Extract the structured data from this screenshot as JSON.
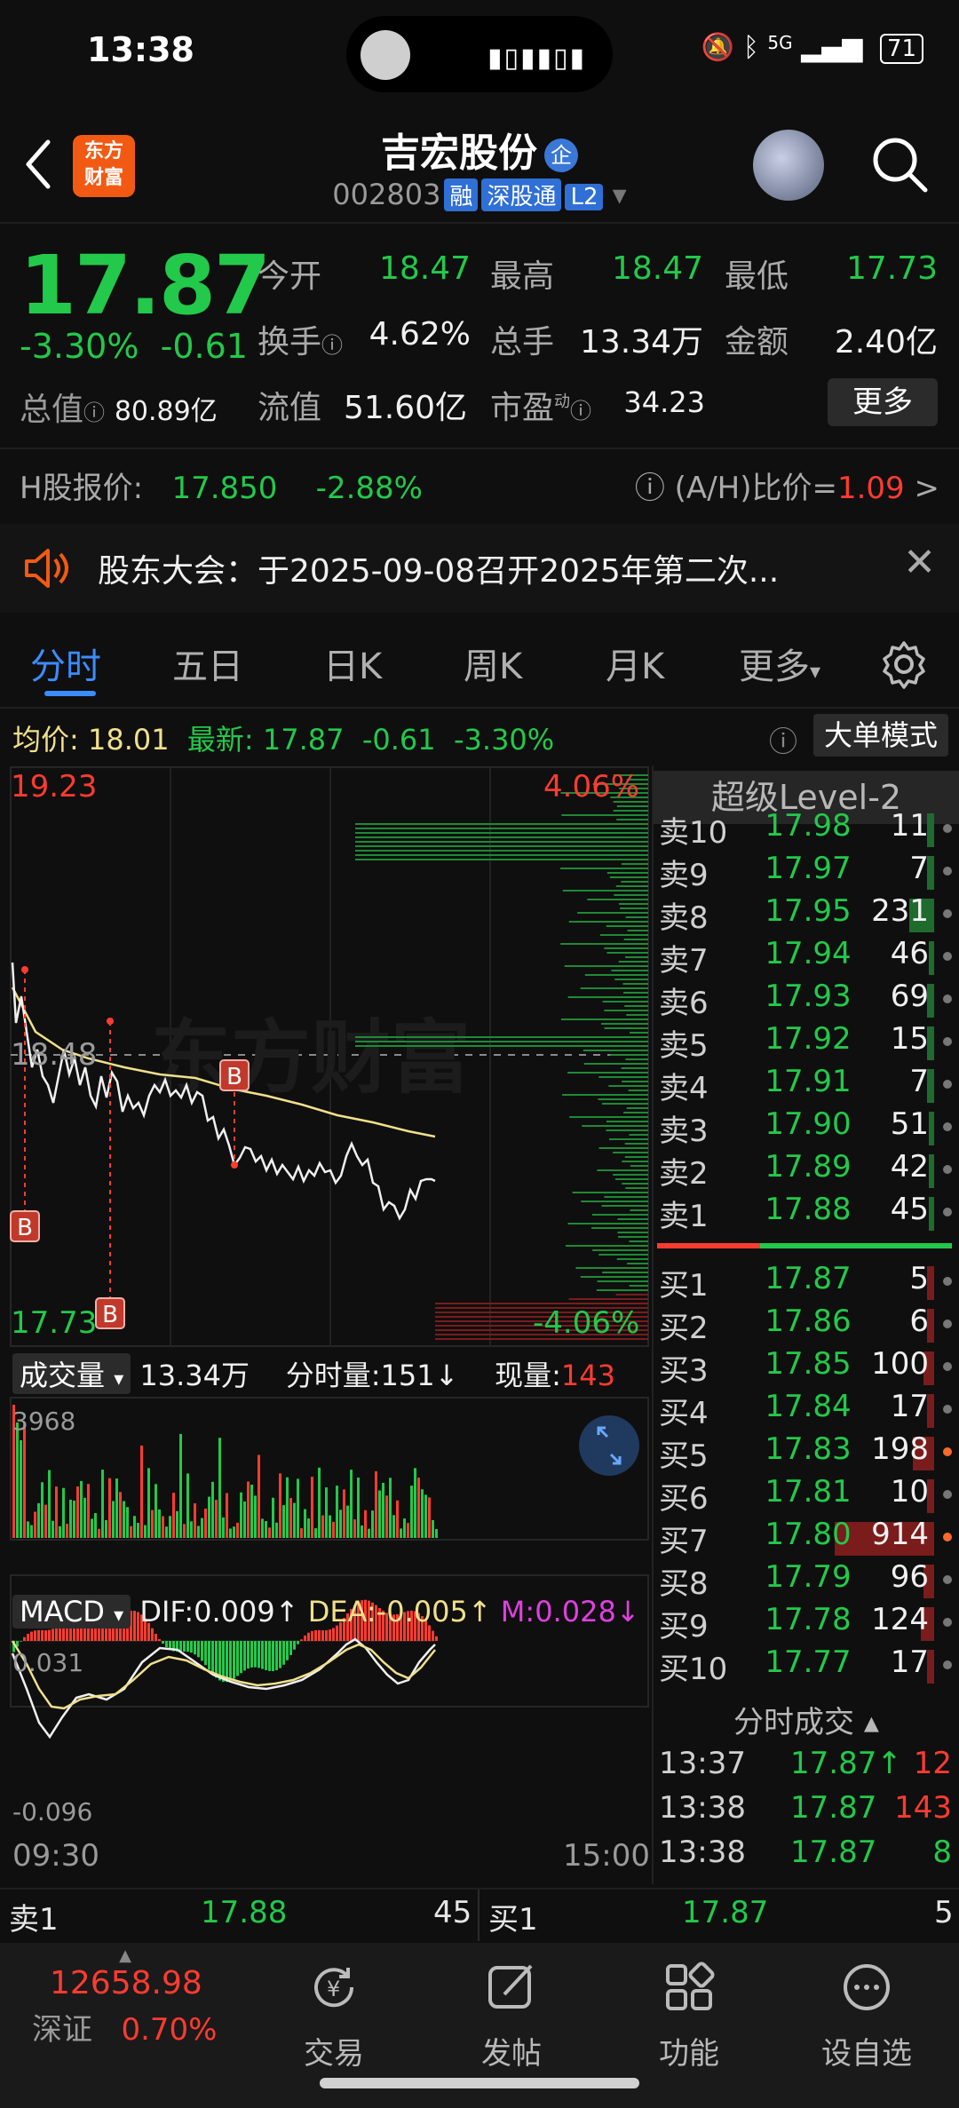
{
  "status": {
    "time": "13:38",
    "network": "5G",
    "battery": "71"
  },
  "header": {
    "logo_line1": "东方",
    "logo_line2": "财富",
    "name": "吉宏股份",
    "name_badge": "企",
    "code": "002803",
    "tags": [
      "融",
      "深股通",
      "L2"
    ]
  },
  "quote": {
    "price": "17.87",
    "chg_pct": "-3.30%",
    "chg": "-0.61",
    "labels": {
      "open": "今开",
      "high": "最高",
      "low": "最低",
      "turnover": "换手",
      "vol": "总手",
      "amount": "金额",
      "mktcap": "总值",
      "float": "流值",
      "pe": "市盈",
      "pe_sup": "动"
    },
    "open": "18.47",
    "high": "18.47",
    "low": "17.73",
    "turnover": "4.62%",
    "vol": "13.34万",
    "amount": "2.40亿",
    "mktcap": "80.89亿",
    "float": "51.60亿",
    "pe": "34.23",
    "more": "更多"
  },
  "hshare": {
    "label": "H股报价:",
    "price": "17.850",
    "pct": "-2.88%",
    "ah_label": "(A/H)比价=",
    "ah": "1.09",
    "arrow": ">"
  },
  "notice": {
    "text": "股东大会：于2025-09-08召开2025年第二次..."
  },
  "tabs": [
    "分时",
    "五日",
    "日K",
    "周K",
    "月K",
    "更多"
  ],
  "avg": {
    "avg_label": "均价:",
    "avg": "18.01",
    "latest_label": "最新:",
    "latest": "17.87",
    "chg": "-0.61",
    "pct": "-3.30%",
    "big_order": "大单模式"
  },
  "chart": {
    "y_high": "19.23",
    "y_high_pct": "4.06%",
    "y_mid": "18.48",
    "y_low": "17.73",
    "y_low_pct": "-4.06%",
    "watermark": "东方财富",
    "vol_label": "成交量",
    "vol_total": "13.34万",
    "tick_vol_label": "分时量:",
    "tick_vol": "151↓",
    "cur_vol_label": "现量:",
    "cur_vol": "143",
    "vol_max": "3968",
    "macd_label": "MACD",
    "dif": "DIF:0.009↑",
    "dea": "DEA:-0.005↑",
    "m": "M:0.028↓",
    "macd_top": "0.031",
    "macd_bot": "-0.096",
    "t_start": "09:30",
    "t_end": "15:00",
    "buy_marker": "B"
  },
  "level2": {
    "title": "超级Level-2",
    "asks": [
      {
        "label": "卖10",
        "price": "17.98",
        "vol": "11"
      },
      {
        "label": "卖9",
        "price": "17.97",
        "vol": "7"
      },
      {
        "label": "卖8",
        "price": "17.95",
        "vol": "231"
      },
      {
        "label": "卖7",
        "price": "17.94",
        "vol": "46"
      },
      {
        "label": "卖6",
        "price": "17.93",
        "vol": "69"
      },
      {
        "label": "卖5",
        "price": "17.92",
        "vol": "15"
      },
      {
        "label": "卖4",
        "price": "17.91",
        "vol": "7"
      },
      {
        "label": "卖3",
        "price": "17.90",
        "vol": "51"
      },
      {
        "label": "卖2",
        "price": "17.89",
        "vol": "42"
      },
      {
        "label": "卖1",
        "price": "17.88",
        "vol": "45"
      }
    ],
    "bids": [
      {
        "label": "买1",
        "price": "17.87",
        "vol": "5"
      },
      {
        "label": "买2",
        "price": "17.86",
        "vol": "6"
      },
      {
        "label": "买3",
        "price": "17.85",
        "vol": "100"
      },
      {
        "label": "买4",
        "price": "17.84",
        "vol": "17"
      },
      {
        "label": "买5",
        "price": "17.83",
        "vol": "198"
      },
      {
        "label": "买6",
        "price": "17.81",
        "vol": "10"
      },
      {
        "label": "买7",
        "price": "17.80",
        "vol": "914"
      },
      {
        "label": "买8",
        "price": "17.79",
        "vol": "96"
      },
      {
        "label": "买9",
        "price": "17.78",
        "vol": "124"
      },
      {
        "label": "买10",
        "price": "17.77",
        "vol": "17"
      }
    ],
    "trades_title": "分时成交",
    "trades": [
      {
        "time": "13:37",
        "price": "17.87↑",
        "vol": "12"
      },
      {
        "time": "13:38",
        "price": "17.87",
        "vol": "143"
      },
      {
        "time": "13:38",
        "price": "17.87",
        "vol": "8"
      }
    ]
  },
  "quickbar": {
    "sell_label": "卖1",
    "sell_price": "17.88",
    "sell_vol": "45",
    "buy_label": "买1",
    "buy_price": "17.87",
    "buy_vol": "5"
  },
  "bottomnav": {
    "index_value": "12658.98",
    "index_name": "深证",
    "index_pct": "0.70%",
    "items": [
      "交易",
      "发帖",
      "功能",
      "设自选"
    ]
  },
  "colors": {
    "up": "#ff3b30",
    "down": "#22c94a",
    "accent": "#3c8cff",
    "avg_line": "#f0e08a"
  }
}
